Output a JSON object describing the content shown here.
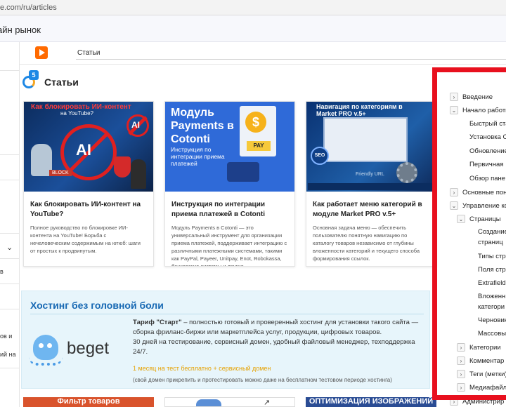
{
  "browser": {
    "url": "e.com/ru/articles"
  },
  "site": {
    "title": "айн рынок"
  },
  "left_column": {
    "items": [
      "в",
      "ов и",
      "ий на"
    ]
  },
  "tab": {
    "label": "Статьи"
  },
  "page": {
    "title": "Статьи",
    "badge": "5"
  },
  "articles": [
    {
      "image_text_a": "Как блокировать ИИ-контент",
      "image_text_b": "на YouTube?",
      "image_block": "BLOCK",
      "image_ai": "AI",
      "title": "Как блокировать ИИ-контент на YouTube?",
      "desc": "Полное руководство по блокировке ИИ-контента на YouTube! Борьба с нечеловеческим содержимым на ютюб: шаги от простых к продвинутым."
    },
    {
      "image_title": "Модуль Payments в Cotonti",
      "image_sub": "Инструкция по интеграции приема платежей",
      "image_coin": "$",
      "image_pay": "PAY",
      "title": "Инструкция по интеграции приема платежей в Cotonti",
      "desc": "Модуль Payments в Cotonti — это универсальный инструмент для организации приема платежей, поддерживает интеграцию с различными платежными системами, такими как PayPal, Payeer, Unitpay, Enot, Robokassa, банковские системы и другие."
    },
    {
      "image_title": "Навигация по категориям в Market PRO v.5+",
      "image_seo": "SEO",
      "image_url": "Friendly URL",
      "title": "Как работает меню категорий в модуле Market PRO v.5+",
      "desc": "Основная задача меню — обеспечить пользователю понятную навигацию по каталогу товаров независимо от глубины вложенности категорий и текущего способа формирования ссылок."
    }
  ],
  "hosting": {
    "heading": "Хостинг без головной боли",
    "logo_text": "beget",
    "tariff_label": "Тариф \"Старт\"",
    "text_1": " – полностью готовый и проверенный хостинг для установки такого сайта — сборка фриланс-биржи или маркетплейса услуг, продукции, цифровых товаров.",
    "text_2": "30 дней на тестирование, сервисный домен, удобный файловый менеджер, техподдержка 24/7.",
    "promo": "1 месяц на тест бесплатно + сервисный домен",
    "note": "(свой домен прикрепить и протестировать можно даже на бесплатном тестовом периоде хостинга)"
  },
  "bottom_cards": [
    "Фильтр товаров",
    "",
    "ОПТИМИЗАЦИЯ ИЗОБРАЖЕНИЙ"
  ],
  "toc": {
    "items": [
      {
        "label": "Введение",
        "toggle": ">"
      },
      {
        "label": "Начало работы",
        "toggle": "v"
      },
      {
        "label": "Быстрый ста"
      },
      {
        "label": "Установка C"
      },
      {
        "label": "Обновление"
      },
      {
        "label": "Первичная"
      },
      {
        "label": "Обзор пане"
      },
      {
        "label": "Основные пон",
        "toggle": ">"
      },
      {
        "label": "Управление ко",
        "toggle": "v"
      },
      {
        "label": "Страницы",
        "toggle": "v"
      },
      {
        "label": "Создание"
      },
      {
        "label": "страниц"
      },
      {
        "label": "Типы стр"
      },
      {
        "label": "Поля стр"
      },
      {
        "label": "Extrafield"
      },
      {
        "label": "Вложенн"
      },
      {
        "label": "категори"
      },
      {
        "label": "Черновик"
      },
      {
        "label": "Массовые"
      },
      {
        "label": "Категории",
        "toggle": ">"
      },
      {
        "label": "Комментар",
        "toggle": ">"
      },
      {
        "label": "Теги (метки)",
        "toggle": ">"
      },
      {
        "label": "Медиафайл",
        "toggle": ">"
      },
      {
        "label": "Администрир",
        "toggle": ">"
      }
    ]
  },
  "colors": {
    "accent": "#1668b3",
    "highlight_frame": "#e8101e",
    "promo": "#e6a100"
  }
}
